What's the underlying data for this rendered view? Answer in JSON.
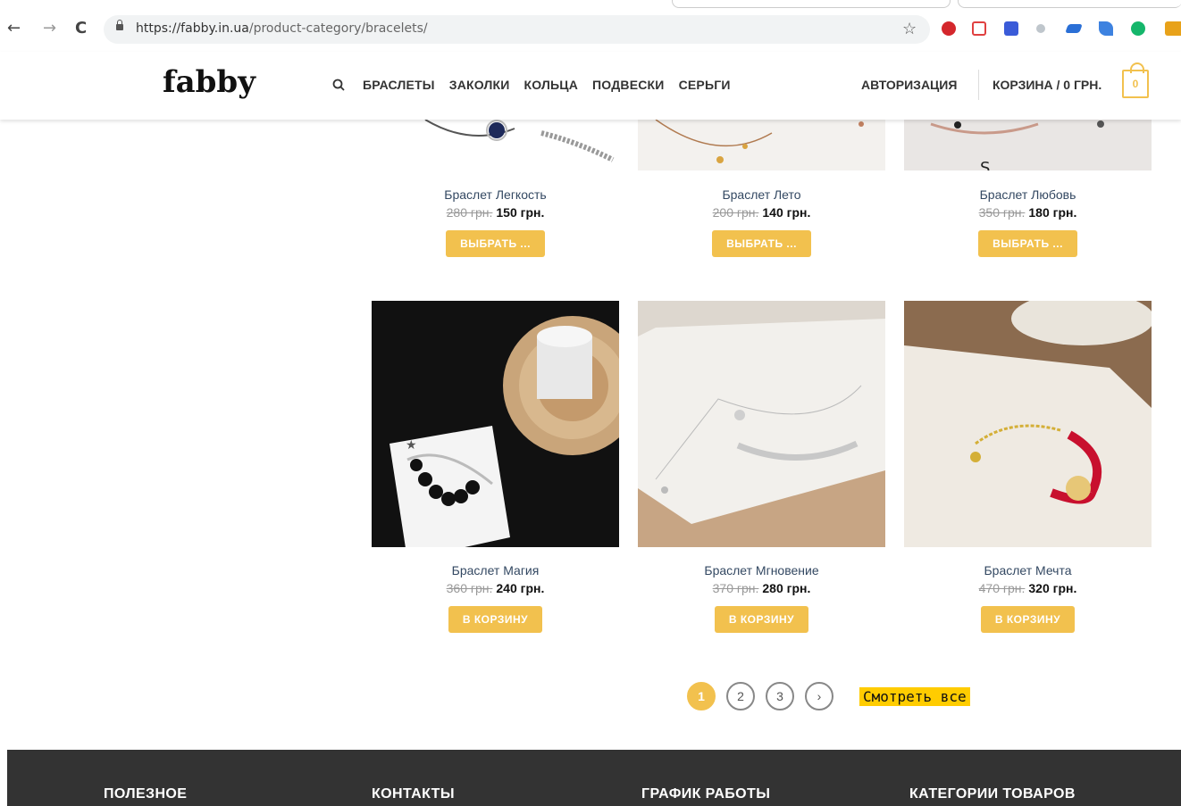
{
  "browser": {
    "back": "←",
    "forward": "→",
    "reload": "C",
    "url_domain": "https://fabby.in.ua",
    "url_path": "/product-category/bracelets/",
    "bookmark_icon": "star-icon",
    "extensions": [
      {
        "name": "abp-extension-icon",
        "color": "#d4272c"
      },
      {
        "name": "red-cross-extension-icon",
        "color": "#e04040"
      },
      {
        "name": "notes-extension-icon",
        "color": "#3a5bd8"
      },
      {
        "name": "moon-extension-icon",
        "color": "#bfc6cc"
      },
      {
        "name": "dictionary-extension-icon",
        "color": "#2a6fd6"
      },
      {
        "name": "bird-extension-icon",
        "color": "#3d82e0"
      },
      {
        "name": "grammarly-extension-icon",
        "color": "#15b66b"
      },
      {
        "name": "coupon-extension-icon",
        "color": "#e8a21a"
      }
    ]
  },
  "header": {
    "logo": "fabby",
    "menu": [
      "БРАСЛЕТЫ",
      "ЗАКОЛКИ",
      "КОЛЬЦА",
      "ПОДВЕСКИ",
      "СЕРЬГИ"
    ],
    "auth": "АВТОРИЗАЦИЯ",
    "cart_label": "КОРЗИНА / 0 ГРН.",
    "cart_count": "0",
    "accent": "#f2c14e"
  },
  "products_row1": [
    {
      "name": "Браслет Легкость",
      "old_price": "280 грн.",
      "new_price": "150 грн.",
      "button": "ВЫБРАТЬ ..."
    },
    {
      "name": "Браслет Лето",
      "old_price": "200 грн.",
      "new_price": "140 грн.",
      "button": "ВЫБРАТЬ ..."
    },
    {
      "name": "Браслет Любовь",
      "old_price": "350 грн.",
      "new_price": "180 грн.",
      "button": "ВЫБРАТЬ ..."
    }
  ],
  "products_row2": [
    {
      "name": "Браслет Магия",
      "old_price": "360 грн.",
      "new_price": "240 грн.",
      "button": "В КОРЗИНУ"
    },
    {
      "name": "Браслет Мгновение",
      "old_price": "370 грн.",
      "new_price": "280 грн.",
      "button": "В КОРЗИНУ"
    },
    {
      "name": "Браслет Мечта",
      "old_price": "470 грн.",
      "new_price": "320 грн.",
      "button": "В КОРЗИНУ"
    }
  ],
  "pagination": {
    "pages": [
      "1",
      "2",
      "3"
    ],
    "current": "1",
    "next": "›",
    "see_all": "Смотреть все"
  },
  "footer": {
    "headings": [
      "ПОЛЕЗНОЕ",
      "КОНТАКТЫ",
      "ГРАФИК РАБОТЫ",
      "КАТЕГОРИИ ТОВАРОВ"
    ]
  }
}
